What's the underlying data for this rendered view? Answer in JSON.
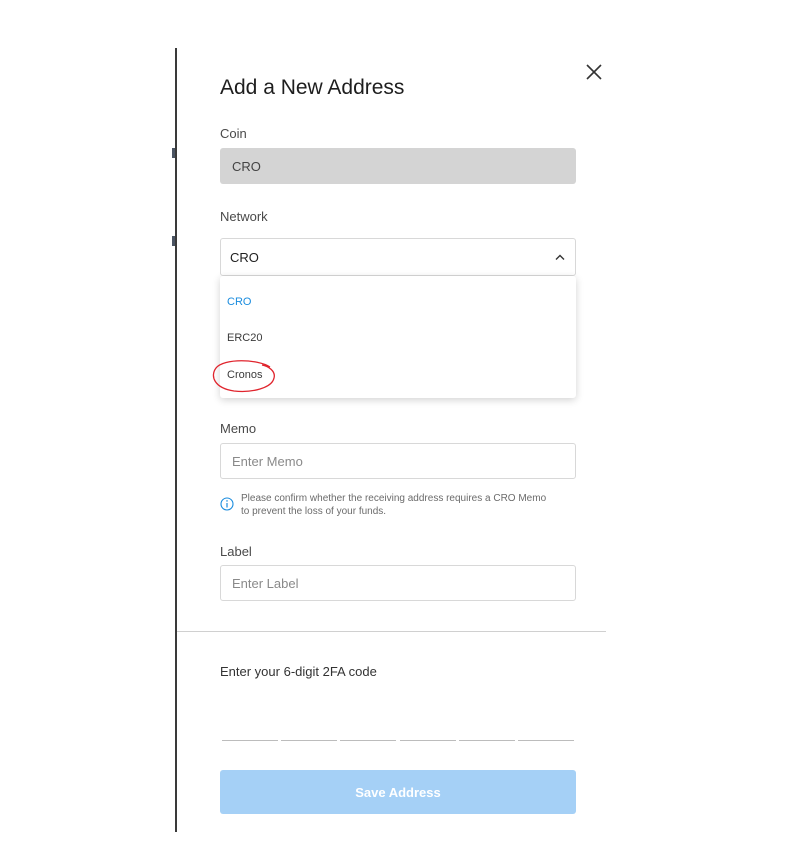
{
  "dialog": {
    "title": "Add a New Address"
  },
  "coin": {
    "label": "Coin",
    "value": "CRO"
  },
  "network": {
    "label": "Network",
    "selected": "CRO",
    "options": [
      {
        "label": "CRO",
        "selected": true
      },
      {
        "label": "ERC20",
        "selected": false
      },
      {
        "label": "Cronos",
        "selected": false,
        "circled": true
      }
    ]
  },
  "memo": {
    "label": "Memo",
    "placeholder": "Enter Memo",
    "info_line1": "Please confirm whether the receiving address requires a CRO Memo",
    "info_line2": "to prevent the loss of your funds."
  },
  "label_field": {
    "label": "Label",
    "placeholder": "Enter Label"
  },
  "twofa": {
    "label": "Enter your 6-digit 2FA code",
    "digits": 6
  },
  "save_button": {
    "label": "Save Address",
    "enabled": false
  },
  "colors": {
    "accent": "#1a8cde",
    "button_disabled": "#a5d0f6",
    "annotation": "#e0242d"
  },
  "icons": {
    "close": "close-icon",
    "chevron": "chevron-up-icon",
    "info": "info-icon"
  }
}
